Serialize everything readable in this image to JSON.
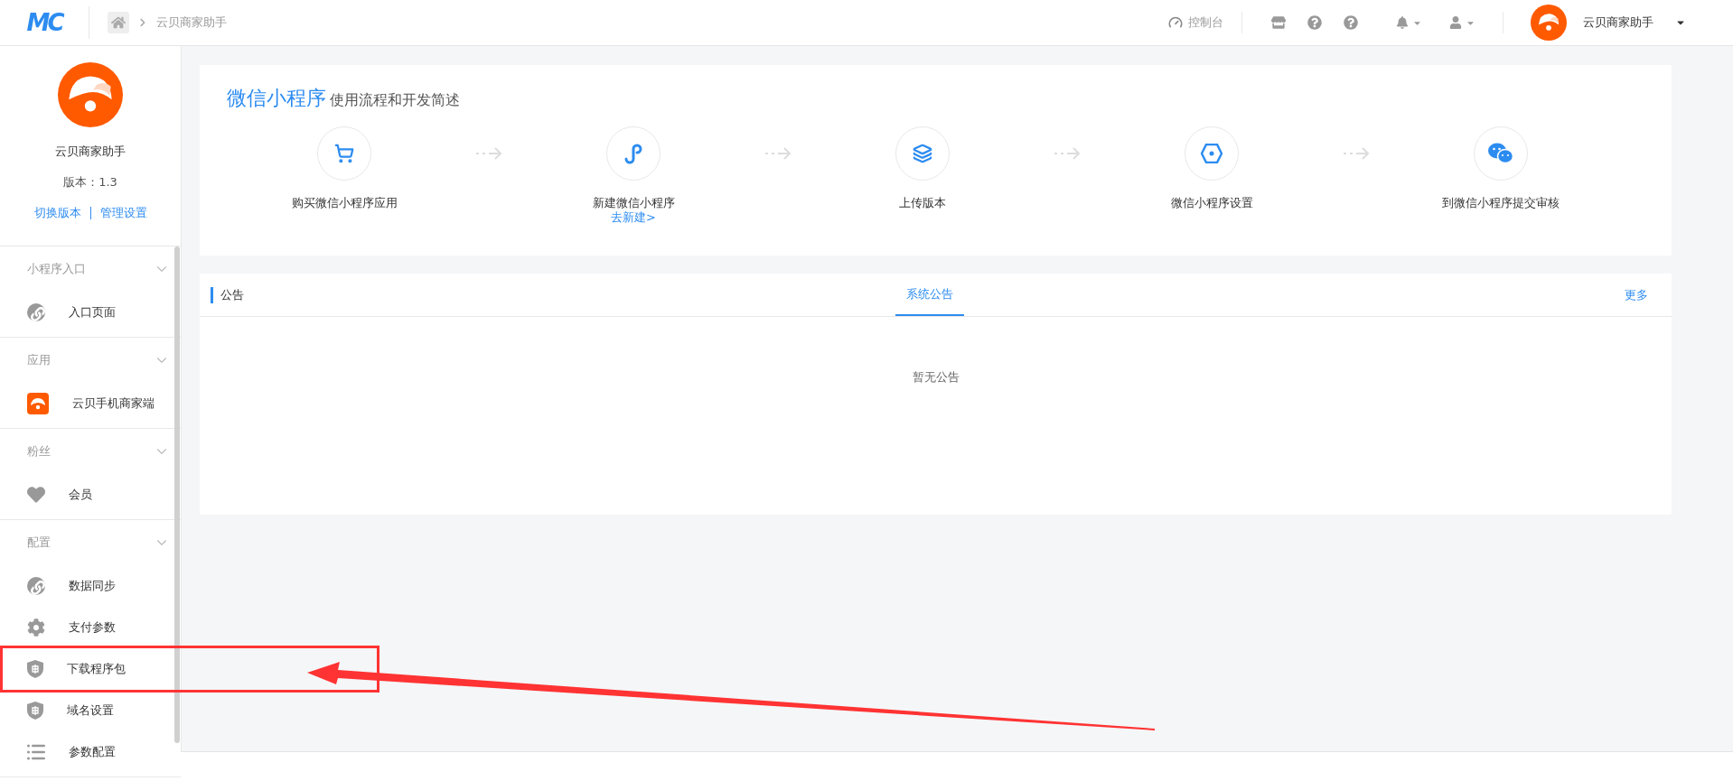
{
  "topbar": {
    "logo": "MC",
    "breadcrumb": "云贝商家助手",
    "console": "控制台",
    "account": "云贝商家助手"
  },
  "app": {
    "name": "云贝商家助手",
    "version": "版本：1.3",
    "links": [
      "切换版本",
      "管理设置"
    ]
  },
  "menu": [
    {
      "title": "小程序入口",
      "items": [
        {
          "label": "入口页面",
          "kind": "link",
          "highlighted": false
        }
      ]
    },
    {
      "title": "应用",
      "items": [
        {
          "label": "云贝手机商家端",
          "kind": "app",
          "highlighted": false
        }
      ]
    },
    {
      "title": "粉丝",
      "items": [
        {
          "label": "会员",
          "kind": "heart",
          "highlighted": false
        }
      ]
    },
    {
      "title": "配置",
      "items": [
        {
          "label": "数据同步",
          "kind": "link",
          "highlighted": false
        },
        {
          "label": "支付参数",
          "kind": "gear",
          "highlighted": false
        },
        {
          "label": "下载程序包",
          "kind": "shield",
          "highlighted": true
        },
        {
          "label": "域名设置",
          "kind": "shield",
          "highlighted": false
        },
        {
          "label": "参数配置",
          "kind": "list",
          "highlighted": false
        }
      ]
    }
  ],
  "flow": {
    "title": "微信小程序",
    "subtitle": "使用流程和开发简述",
    "steps": [
      {
        "label": "购买微信小程序应用",
        "kind": "cart"
      },
      {
        "label": "新建微信小程序",
        "kind": "miniprogram",
        "link": "去新建>"
      },
      {
        "label": "上传版本",
        "kind": "layers"
      },
      {
        "label": "微信小程序设置",
        "kind": "hexagon"
      },
      {
        "label": "到微信小程序提交审核",
        "kind": "chat"
      }
    ]
  },
  "notice": {
    "heading": "公告",
    "tabs": [
      {
        "label": "系统公告",
        "selected": true
      }
    ],
    "more": "更多",
    "empty": "暂无公告"
  }
}
